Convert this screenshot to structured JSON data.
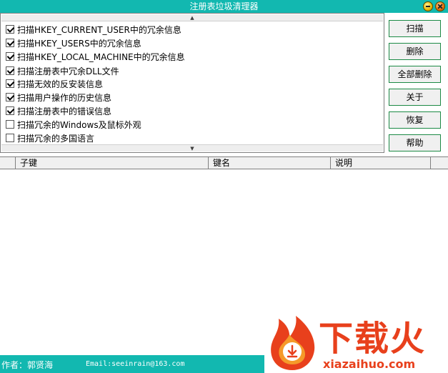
{
  "window": {
    "title": "注册表垃圾清理器"
  },
  "options": [
    {
      "label": "扫描HKEY_CURRENT_USER中的冗余信息",
      "checked": true
    },
    {
      "label": "扫描HKEY_USERS中的冗余信息",
      "checked": true
    },
    {
      "label": "扫描HKEY_LOCAL_MACHINE中的冗余信息",
      "checked": true
    },
    {
      "label": "扫描注册表中冗余DLL文件",
      "checked": true
    },
    {
      "label": "扫描无效的反安装信息",
      "checked": true
    },
    {
      "label": "扫描用户操作的历史信息",
      "checked": true
    },
    {
      "label": "扫描注册表中的错误信息",
      "checked": true
    },
    {
      "label": "扫描冗余的Windows及鼠标外观",
      "checked": false
    },
    {
      "label": "扫描冗余的多国语言",
      "checked": false
    }
  ],
  "buttons": {
    "scan": "扫描",
    "delete": "删除",
    "delete_all": "全部删除",
    "about": "关于",
    "restore": "恢复",
    "help": "帮助"
  },
  "list": {
    "columns": [
      "子键",
      "键名",
      "说明"
    ]
  },
  "status": {
    "author": "作者：郭贤海",
    "email": "Email:seeinrain@163.com"
  },
  "watermark": {
    "brand": "下载火",
    "domain": "xiazaihuo.com"
  },
  "icons": {
    "minimize": "minimize-icon",
    "close": "close-icon",
    "scroll_up": "triangle-up-icon",
    "scroll_down": "triangle-down-icon"
  },
  "colors": {
    "titlebar": "#12b8b0",
    "button_border": "#1c8a45",
    "watermark": "#e8401c"
  }
}
